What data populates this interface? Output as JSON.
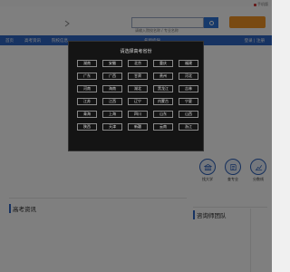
{
  "top_bar": {
    "phone_label": "手机版"
  },
  "search": {
    "placeholder": "请输入院校名称 / 专业名称",
    "value": ""
  },
  "header": {
    "register_label": ""
  },
  "nav": {
    "items": [
      "首页",
      "高考资讯",
      "院校信息",
      "",
      "",
      "",
      "",
      "",
      "",
      "名师指导"
    ],
    "login_label": "登录 | 注册"
  },
  "modal": {
    "title": "请选择高考省份",
    "provinces": [
      "湖南",
      "安徽",
      "北京",
      "重庆",
      "福建",
      "广东",
      "广西",
      "甘肃",
      "贵州",
      "河北",
      "河南",
      "海南",
      "湖北",
      "黑龙江",
      "吉林",
      "江苏",
      "江西",
      "辽宁",
      "内蒙古",
      "宁夏",
      "青海",
      "上海",
      "四川",
      "山东",
      "山西",
      "陕西",
      "天津",
      "新疆",
      "云南",
      "浙江"
    ]
  },
  "features": [
    {
      "label": "找大学",
      "icon": "university-icon"
    },
    {
      "label": "查专业",
      "icon": "major-icon"
    },
    {
      "label": "分数线",
      "icon": "score-icon"
    }
  ],
  "sections": {
    "news_title": "高考资讯",
    "consult_title": "咨询师团队"
  },
  "colors": {
    "nav_blue": "#2f66c5",
    "search_blue": "#2f74d6",
    "accent_orange": "#f29424",
    "modal_bg": "#141414"
  }
}
